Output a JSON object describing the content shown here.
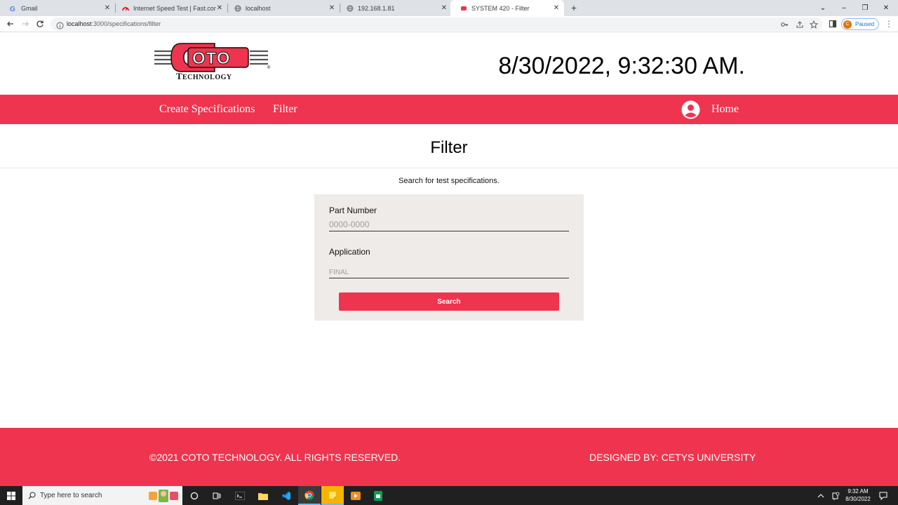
{
  "browser": {
    "tabs": [
      {
        "label": "Gmail",
        "icon": "gmail-icon"
      },
      {
        "label": "Internet Speed Test | Fast.com",
        "icon": "speedometer-icon"
      },
      {
        "label": "localhost",
        "icon": "globe-icon"
      },
      {
        "label": "192.168.1.81",
        "icon": "globe-icon"
      },
      {
        "label": "SYSTEM 420 - Filter",
        "icon": "coto-icon",
        "active": true
      }
    ],
    "url_host": "localhost",
    "url_path": ":3000/specifications/filter",
    "profile_initial": "C",
    "profile_status": "Paused"
  },
  "header": {
    "logo_text": "COTO",
    "logo_subtext": "TECHNOLOGY",
    "logo_registered": "®",
    "datetime": "8/30/2022, 9:32:30 AM."
  },
  "navbar": {
    "create_specifications": "Create Specifications",
    "filter": "Filter",
    "home": "Home"
  },
  "main": {
    "title": "Filter",
    "subtitle": "Search for test specifications.",
    "part_number_label": "Part Number",
    "part_number_placeholder": "0000-0000",
    "part_number_value": "",
    "application_label": "Application",
    "application_placeholder": "FINAL",
    "application_value": "",
    "search_button": "Search"
  },
  "footer": {
    "copyright": "©2021 COTO TECHNOLOGY. ALL RIGHTS RESERVED.",
    "designed_by": "DESIGNED BY: CETYS UNIVERSITY"
  },
  "taskbar": {
    "search_placeholder": "Type here to search",
    "time": "9:32 AM",
    "date": "8/30/2022"
  },
  "colors": {
    "brand_red": "#ee344e",
    "card_background": "#efebe9"
  }
}
